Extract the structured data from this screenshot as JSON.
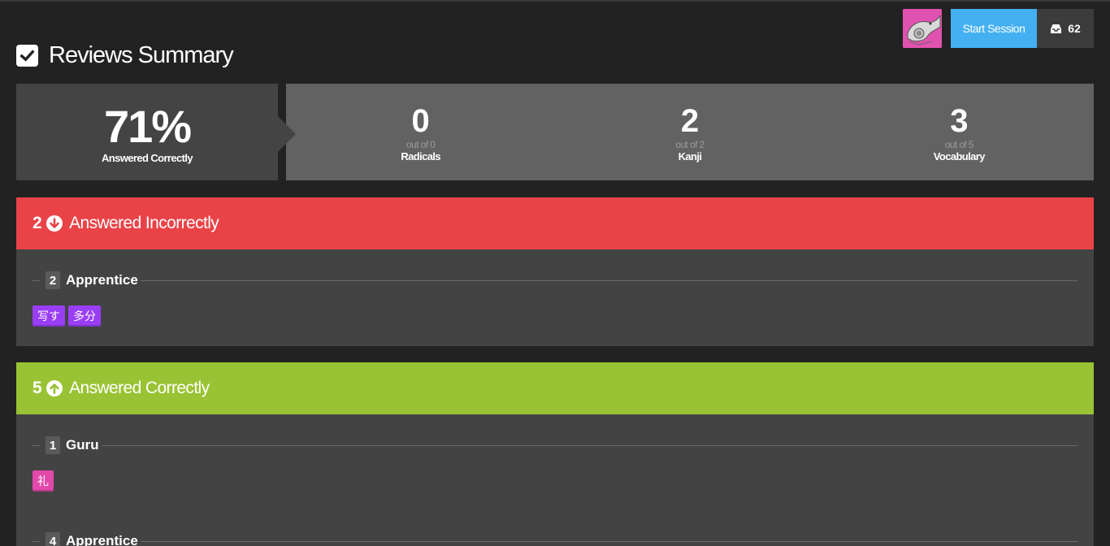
{
  "header": {
    "title": "Reviews Summary",
    "start_session": "Start Session",
    "inbox_count": "62"
  },
  "stats": {
    "percent": "71%",
    "percent_label": "Answered Correctly",
    "radicals": {
      "value": "0",
      "outof": "out of 0",
      "label": "Radicals"
    },
    "kanji": {
      "value": "2",
      "outof": "out of 2",
      "label": "Kanji"
    },
    "vocabulary": {
      "value": "3",
      "outof": "out of 5",
      "label": "Vocabulary"
    }
  },
  "incorrect": {
    "count": "2",
    "label": "Answered Incorrectly",
    "color": "#e94348",
    "groups": [
      {
        "count": "2",
        "name": "Apprentice",
        "items": [
          "写す",
          "多分"
        ]
      }
    ]
  },
  "correct": {
    "count": "5",
    "label": "Answered Correctly",
    "color": "#99c334",
    "groups": [
      {
        "count": "1",
        "name": "Guru",
        "items": [
          "礼"
        ]
      },
      {
        "count": "4",
        "name": "Apprentice"
      }
    ]
  },
  "colors": {
    "vocabulary": "#9a3ef5",
    "kanji": "#e249ab",
    "start_button": "#44b0f2"
  }
}
